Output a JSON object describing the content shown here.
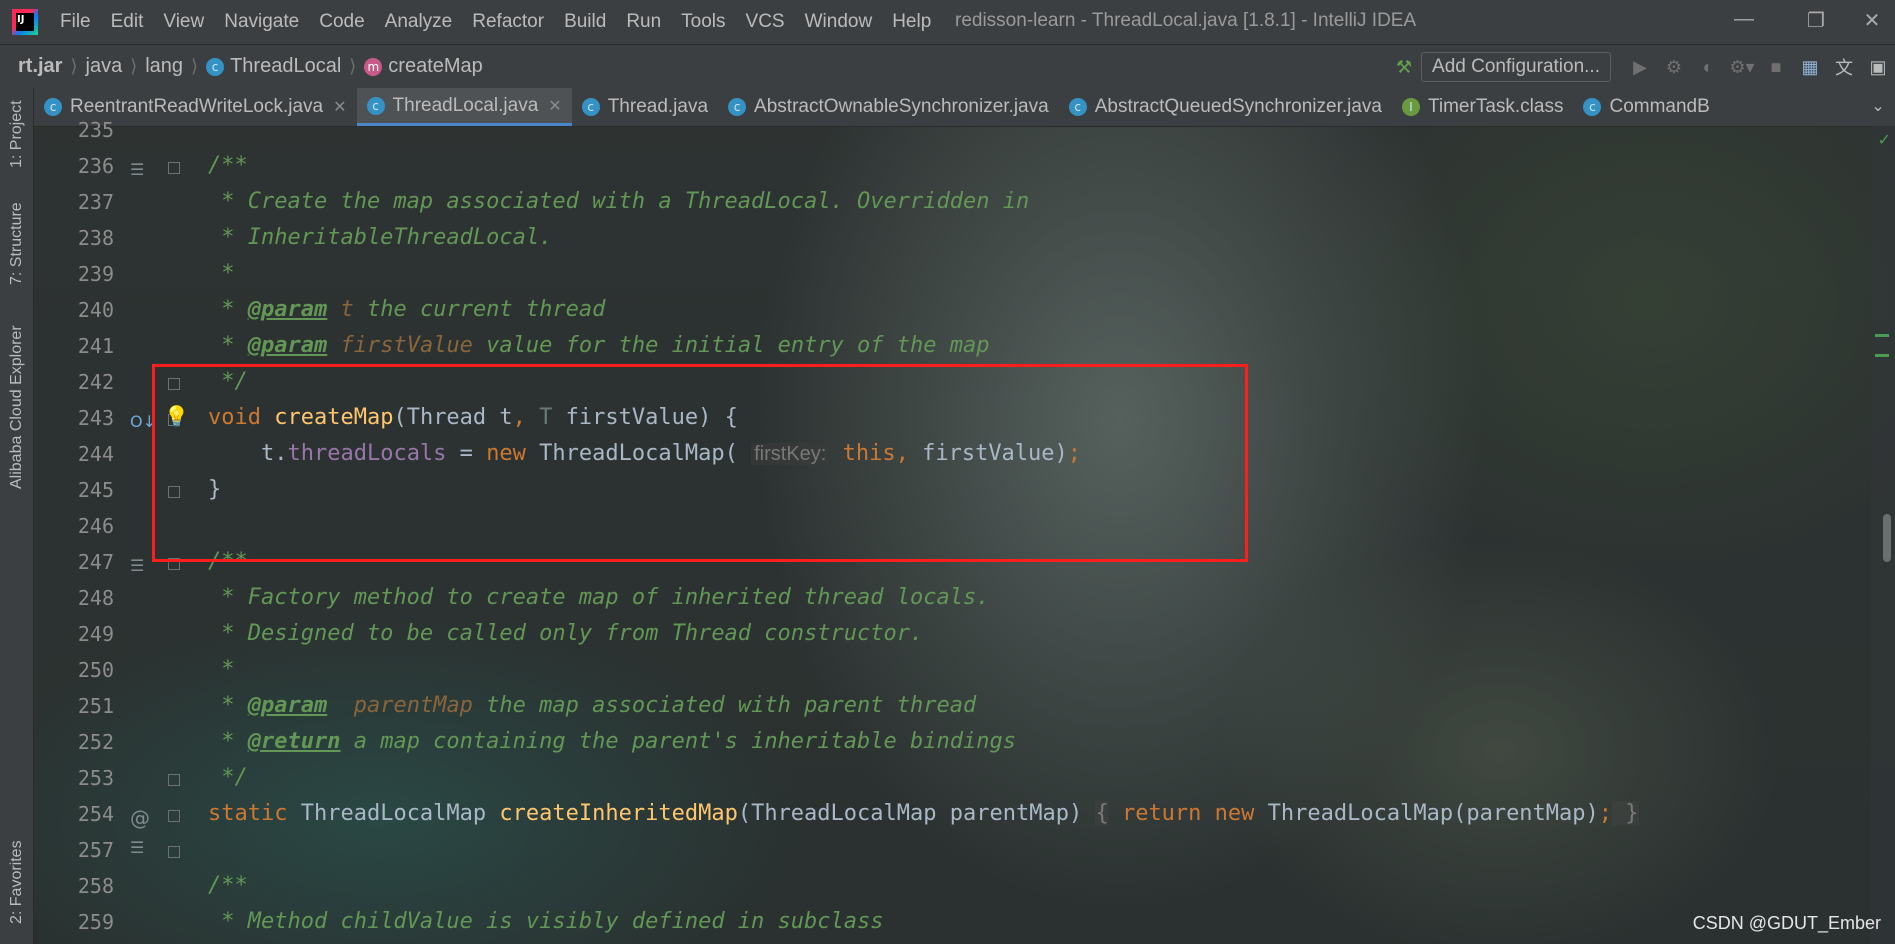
{
  "menu": {
    "items": [
      "File",
      "Edit",
      "View",
      "Navigate",
      "Code",
      "Analyze",
      "Refactor",
      "Build",
      "Run",
      "Tools",
      "VCS",
      "Window",
      "Help"
    ],
    "window_title": "redisson-learn - ThreadLocal.java [1.8.1] - IntelliJ IDEA"
  },
  "breadcrumb": {
    "jar": "rt.jar",
    "pkg1": "java",
    "pkg2": "lang",
    "cls": "ThreadLocal",
    "method": "createMap",
    "cls_badge": "c",
    "method_badge": "m"
  },
  "toolbar": {
    "add_config": "Add Configuration..."
  },
  "tabs": [
    {
      "label": "ReentrantReadWriteLock.java",
      "badge": "c"
    },
    {
      "label": "ThreadLocal.java",
      "badge": "c"
    },
    {
      "label": "Thread.java",
      "badge": "c"
    },
    {
      "label": "AbstractOwnableSynchronizer.java",
      "badge": "c"
    },
    {
      "label": "AbstractQueuedSynchronizer.java",
      "badge": "c"
    },
    {
      "label": "TimerTask.class",
      "badge": "I"
    },
    {
      "label": "CommandB",
      "badge": "c"
    }
  ],
  "side_tabs": {
    "project": "1: Project",
    "structure": "7: Structure",
    "cloud": "Alibaba Cloud Explorer",
    "favorites": "2: Favorites"
  },
  "line_numbers": [
    "235",
    "236",
    "237",
    "238",
    "239",
    "240",
    "241",
    "242",
    "243",
    "244",
    "245",
    "246",
    "247",
    "248",
    "249",
    "250",
    "251",
    "252",
    "253",
    "254",
    "257",
    "258",
    "259"
  ],
  "code": {
    "l236": "/**",
    "l237": " * Create the map associated with a ThreadLocal. Overridden in",
    "l238": " * InheritableThreadLocal.",
    "l239": " *",
    "l240_pre": " * ",
    "l240_tag": "@param",
    "l240_name": " t",
    "l240_desc": " the current thread",
    "l241_pre": " * ",
    "l241_tag": "@param",
    "l241_name": " firstValue",
    "l241_desc": " value for the initial entry of the map",
    "l242": " */",
    "l243_kw": "void",
    "l243_fn": "createMap",
    "l243_a": "(Thread t",
    "l243_comma": ",",
    "l243_T": " T",
    "l243_b": " firstValue) {",
    "l244_a": "    t.",
    "l244_field": "threadLocals",
    "l244_b": " = ",
    "l244_new": "new",
    "l244_c": " ThreadLocalMap(",
    "l244_hint": "firstKey:",
    "l244_this": "this",
    "l244_comma": ",",
    "l244_d": " firstValue)",
    "l244_semi": ";",
    "l245": "}",
    "l247": "/**",
    "l248": " * Factory method to create map of inherited thread locals.",
    "l249": " * Designed to be called only from Thread constructor.",
    "l250": " *",
    "l251_pre": " * ",
    "l251_tag": "@param",
    "l251_name": "  parentMap",
    "l251_desc": " the map associated with parent thread",
    "l252_pre": " * ",
    "l252_tag": "@return",
    "l252_desc": " a map containing the parent's inheritable bindings",
    "l253": " */",
    "l254_kw": "static",
    "l254_a": " ThreadLocalMap ",
    "l254_fn": "createInheritedMap",
    "l254_b": "(ThreadLocalMap parentMap) ",
    "l254_lb": "{",
    "l254_ret": " return",
    "l254_new": " new",
    "l254_c": " ThreadLocalMap(parentMap)",
    "l254_semi": ";",
    "l254_rb": " }",
    "l258": "/**",
    "l259": " * Method childValue is visibly defined in subclass"
  },
  "gutter_icons": {
    "l243": "O↓",
    "l254": "@"
  },
  "watermark": "CSDN @GDUT_Ember",
  "colors": {
    "keyword": "#cc7832",
    "method": "#ffc66d",
    "comment": "#629755",
    "field": "#9876aa",
    "highlight_box": "#ff1e1e"
  }
}
